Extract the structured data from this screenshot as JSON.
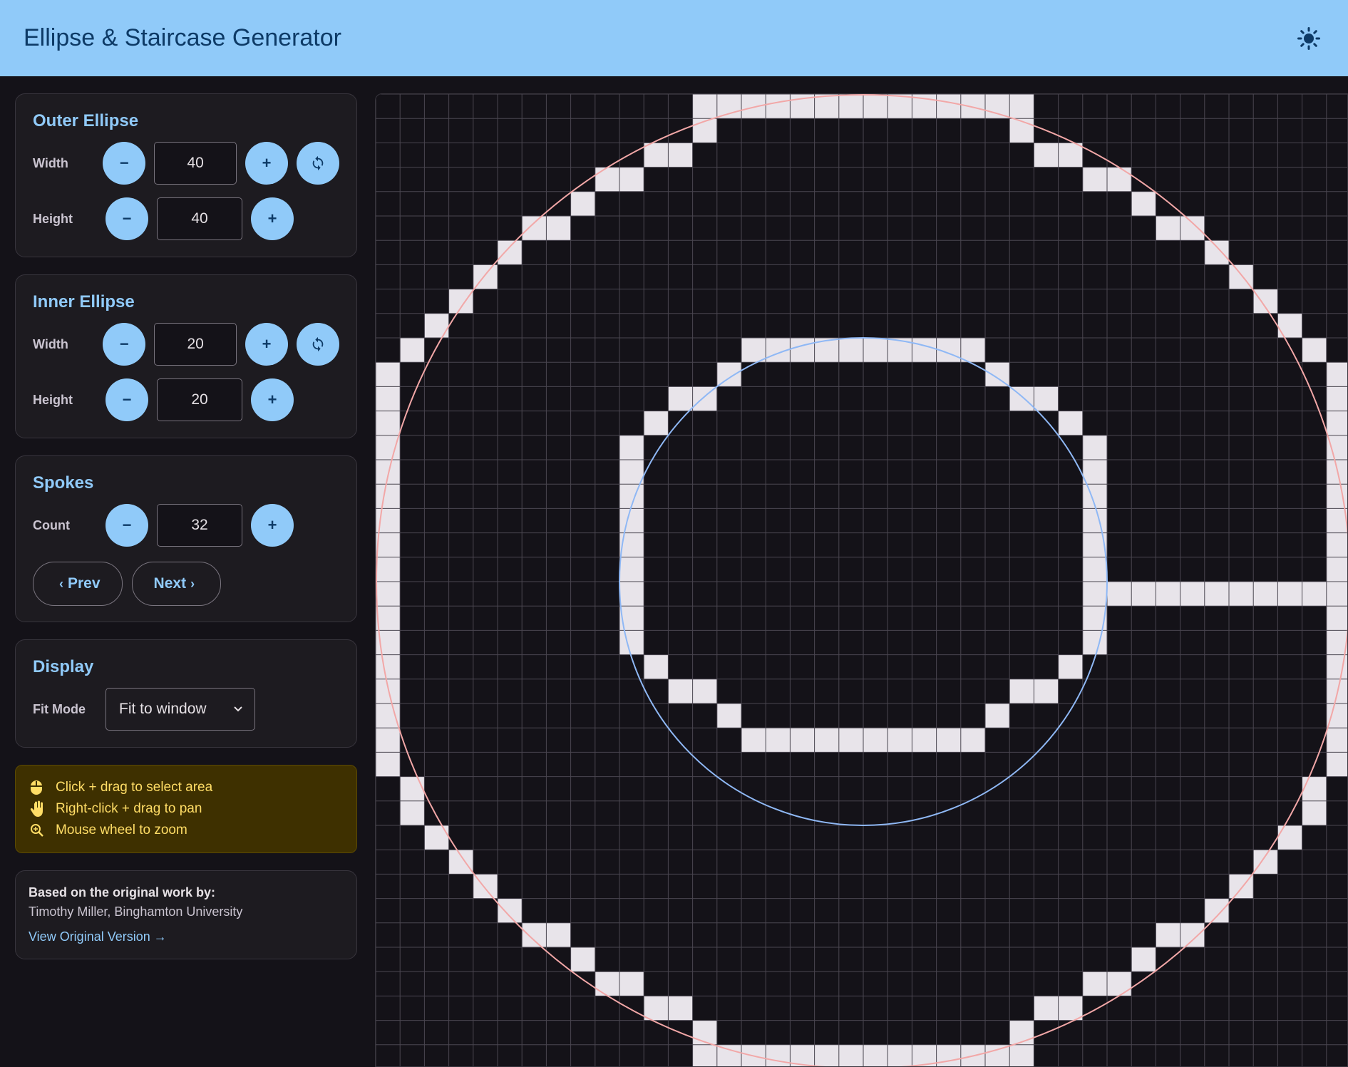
{
  "app": {
    "title": "Ellipse & Staircase Generator",
    "theme_icon": "sun-icon"
  },
  "outer": {
    "title": "Outer Ellipse",
    "width_label": "Width",
    "width": "40",
    "height_label": "Height",
    "height": "40",
    "minus": "−",
    "plus": "+"
  },
  "inner": {
    "title": "Inner Ellipse",
    "width_label": "Width",
    "width": "20",
    "height_label": "Height",
    "height": "20",
    "minus": "−",
    "plus": "+"
  },
  "spokes": {
    "title": "Spokes",
    "count_label": "Count",
    "count": "32",
    "minus": "−",
    "plus": "+",
    "prev": "Prev",
    "next": "Next"
  },
  "display": {
    "title": "Display",
    "fit_label": "Fit Mode",
    "fit_value": "Fit to window"
  },
  "help": {
    "select": "Click + drag to select area",
    "pan": "Right-click + drag to pan",
    "zoom": "Mouse wheel to zoom"
  },
  "credit": {
    "heading": "Based on the original work by:",
    "author": "Timothy Miller, Binghamton University",
    "link": "View Original Version →"
  },
  "grid": {
    "cell_color": "#e8e4ea",
    "outer_guide_color": "#f2a7a7",
    "inner_guide_color": "#8fb8f5",
    "outer_rows": [
      [
        13,
        26
      ],
      [
        11,
        12,
        27,
        28
      ],
      [
        9,
        10,
        29,
        30
      ],
      [
        8,
        31
      ],
      [
        6,
        7,
        32,
        33
      ],
      [
        5,
        34
      ],
      [
        4,
        35
      ],
      [
        3,
        36
      ],
      [
        2,
        37
      ],
      [
        1,
        38
      ],
      [
        0,
        39
      ],
      [
        0,
        39
      ],
      [
        0,
        39
      ],
      [
        0,
        39
      ],
      [
        0,
        39
      ],
      [
        0,
        39
      ],
      [
        0,
        39
      ],
      [
        0,
        39
      ],
      [
        0,
        39
      ],
      [
        0,
        39
      ],
      [
        0,
        39
      ],
      [
        0,
        39
      ],
      [
        0,
        39
      ],
      [
        0,
        39
      ],
      [
        0,
        39
      ],
      [
        0,
        39
      ],
      [
        0,
        39
      ],
      [
        1,
        38
      ],
      [
        1,
        38
      ],
      [
        2,
        37
      ],
      [
        3,
        36
      ],
      [
        4,
        35
      ],
      [
        5,
        34
      ],
      [
        6,
        7,
        32,
        33
      ],
      [
        8,
        31
      ],
      [
        9,
        10,
        29,
        30
      ],
      [
        11,
        12,
        27,
        28
      ],
      [
        13,
        26
      ]
    ],
    "outer_caps": [
      [
        0,
        13,
        26
      ],
      [
        39,
        13,
        26
      ]
    ],
    "inner_rows": [
      [
        15,
        24
      ],
      [
        14,
        25
      ],
      [
        12,
        13,
        26,
        27
      ],
      [
        11,
        28
      ],
      [
        10,
        29
      ],
      [
        10,
        29
      ],
      [
        10,
        29
      ],
      [
        10,
        29
      ],
      [
        10,
        29
      ],
      [
        10,
        29
      ],
      [
        10,
        29
      ],
      [
        10,
        29
      ],
      [
        10,
        29
      ],
      [
        11,
        28
      ],
      [
        12,
        13,
        26,
        27
      ],
      [
        14,
        25
      ],
      [
        15,
        24
      ]
    ],
    "inner_top_row": 10,
    "spoke_row": 20,
    "spoke_cols": [
      30,
      39
    ]
  }
}
